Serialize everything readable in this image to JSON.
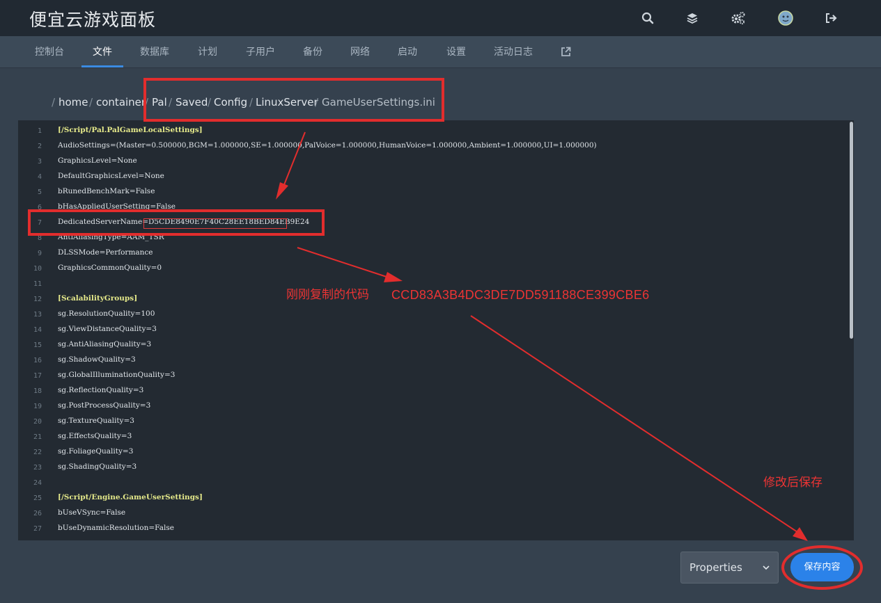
{
  "app": {
    "title": "便宜云游戏面板"
  },
  "header_icons": [
    "search-icon",
    "layers-icon",
    "cogs-icon",
    "avatar",
    "logout-icon"
  ],
  "nav": {
    "items": [
      "控制台",
      "文件",
      "数据库",
      "计划",
      "子用户",
      "备份",
      "网络",
      "启动",
      "设置",
      "活动日志"
    ],
    "active": "文件",
    "external_icon": "external-link-icon"
  },
  "breadcrumb": {
    "sep": "/",
    "dirs": [
      "home",
      "container",
      "Pal",
      "Saved",
      "Config",
      "LinuxServer"
    ],
    "file": "GameUserSettings.ini"
  },
  "editor": {
    "lines": [
      "[/Script/Pal.PalGameLocalSettings]",
      "AudioSettings=(Master=0.500000,BGM=1.000000,SE=1.000000,PalVoice=1.000000,HumanVoice=1.000000,Ambient=1.000000,UI=1.000000)",
      "GraphicsLevel=None",
      "DefaultGraphicsLevel=None",
      "bRunedBenchMark=False",
      "bHasAppliedUserSetting=False",
      "DedicatedServerName=D5CDE8490E7F40C28EE18BED84EB9E24",
      "AntiAliasingType=AAM_TSR",
      "DLSSMode=Performance",
      "GraphicsCommonQuality=0",
      "",
      "[ScalabilityGroups]",
      "sg.ResolutionQuality=100",
      "sg.ViewDistanceQuality=3",
      "sg.AntiAliasingQuality=3",
      "sg.ShadowQuality=3",
      "sg.GlobalIlluminationQuality=3",
      "sg.ReflectionQuality=3",
      "sg.PostProcessQuality=3",
      "sg.TextureQuality=3",
      "sg.EffectsQuality=3",
      "sg.FoliageQuality=3",
      "sg.ShadingQuality=3",
      "",
      "[/Script/Engine.GameUserSettings]",
      "bUseVSync=False",
      "bUseDynamicResolution=False"
    ]
  },
  "annotations": {
    "copied_label": "刚刚复制的代码",
    "copied_code": "CCD83A3B4DC3DE7DD591188CE399CBE6",
    "save_hint": "修改后保存"
  },
  "footer": {
    "select_value": "Properties",
    "save_label": "保存内容"
  },
  "colors": {
    "accent": "#2b82e9",
    "annotation": "#e22d2d",
    "section_header": "#e5e98a"
  }
}
